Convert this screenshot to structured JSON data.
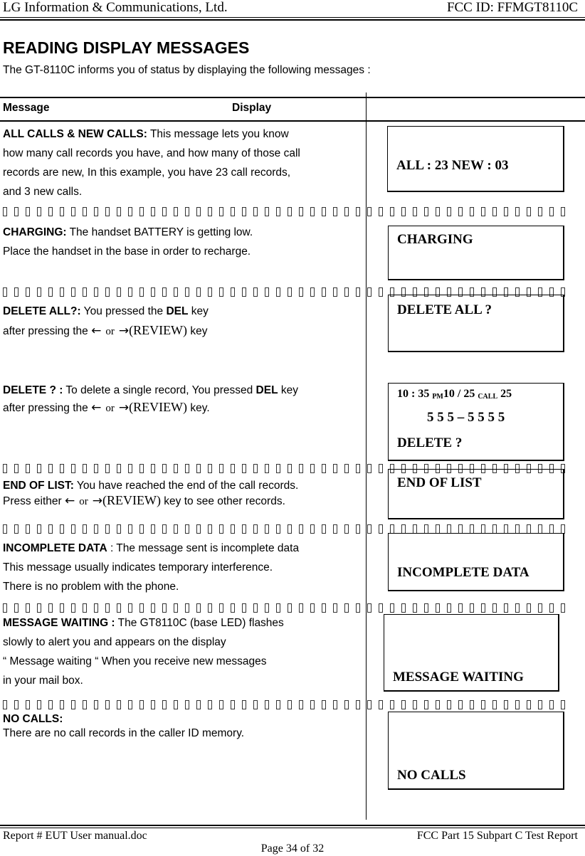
{
  "page_header": {
    "company": "LG Information & Communications, Ltd.",
    "fcc_id": "FCC ID: FFMGT8110C"
  },
  "section": {
    "title": "READING DISPLAY MESSAGES",
    "intro": "The GT-8110C informs you of status by displaying the following messages :"
  },
  "table_header": {
    "message": "Message",
    "display": "Display"
  },
  "icons": {
    "left_arrow": "←",
    "right_arrow": "→",
    "or": "or",
    "review": "(REVIEW)"
  },
  "entries": [
    {
      "id": "all-calls-new-calls",
      "label": "ALL CALLS & NEW CALLS:",
      "lines": [
        " This message lets you know",
        "how many call records you have, and how many of those call",
        "records are new, In this example, you have 23 call records,",
        "and 3 new calls."
      ],
      "display": [
        "ALL : 23  NEW : 03"
      ]
    },
    {
      "id": "charging",
      "label": "CHARGING:",
      "lines": [
        " The handset BATTERY is getting low.",
        "Place the handset in the base in order to recharge."
      ],
      "display": [
        "CHARGING"
      ]
    },
    {
      "id": "delete-all",
      "label": "DELETE ALL?:",
      "lines": [
        " You pressed the ",
        "DEL",
        " key",
        "after pressing the ",
        " key"
      ],
      "display": [
        "DELETE ALL ?"
      ]
    },
    {
      "id": "delete-single",
      "label": "DELETE ? :",
      "lines": [
        " To delete a single record, You pressed ",
        "DEL",
        " key",
        "after pressing the ",
        " key."
      ],
      "display": {
        "time": "10 : 35",
        "ampm": "PM",
        "date": "10 / 25",
        "call_label": "CALL",
        "call_count": "25",
        "number": "5 5 5 – 5 5 5 5",
        "prompt": "DELETE ?"
      }
    },
    {
      "id": "end-of-list",
      "label": "END OF LIST:",
      "lines": [
        " You have reached the end of the call records.",
        "Press either ",
        " key to see other records."
      ],
      "display": [
        "END OF LIST"
      ]
    },
    {
      "id": "incomplete-data",
      "label": "INCOMPLETE DATA",
      "lines": [
        " : The message sent is incomplete data",
        "This message usually indicates temporary interference.",
        "There is no problem with the phone."
      ],
      "display": [
        "INCOMPLETE  DATA"
      ]
    },
    {
      "id": "message-waiting",
      "label": "MESSAGE WAITING :",
      "lines": [
        " The GT8110C (base LED) flashes",
        "slowly to alert you and appears on the display",
        "“ Message waiting “ When you receive new messages",
        "in your mail box."
      ],
      "display": [
        "MESSAGE WAITING"
      ]
    },
    {
      "id": "no-calls",
      "label": "NO CALLS:",
      "lines": [
        "There are no call records in the caller ID memory."
      ],
      "display": [
        "NO CALLS"
      ]
    }
  ],
  "page_footer": {
    "report": "Report # EUT User manual.doc",
    "report_type": "FCC Part 15 Subpart C Test Report",
    "page": "Page 34 of 32"
  }
}
